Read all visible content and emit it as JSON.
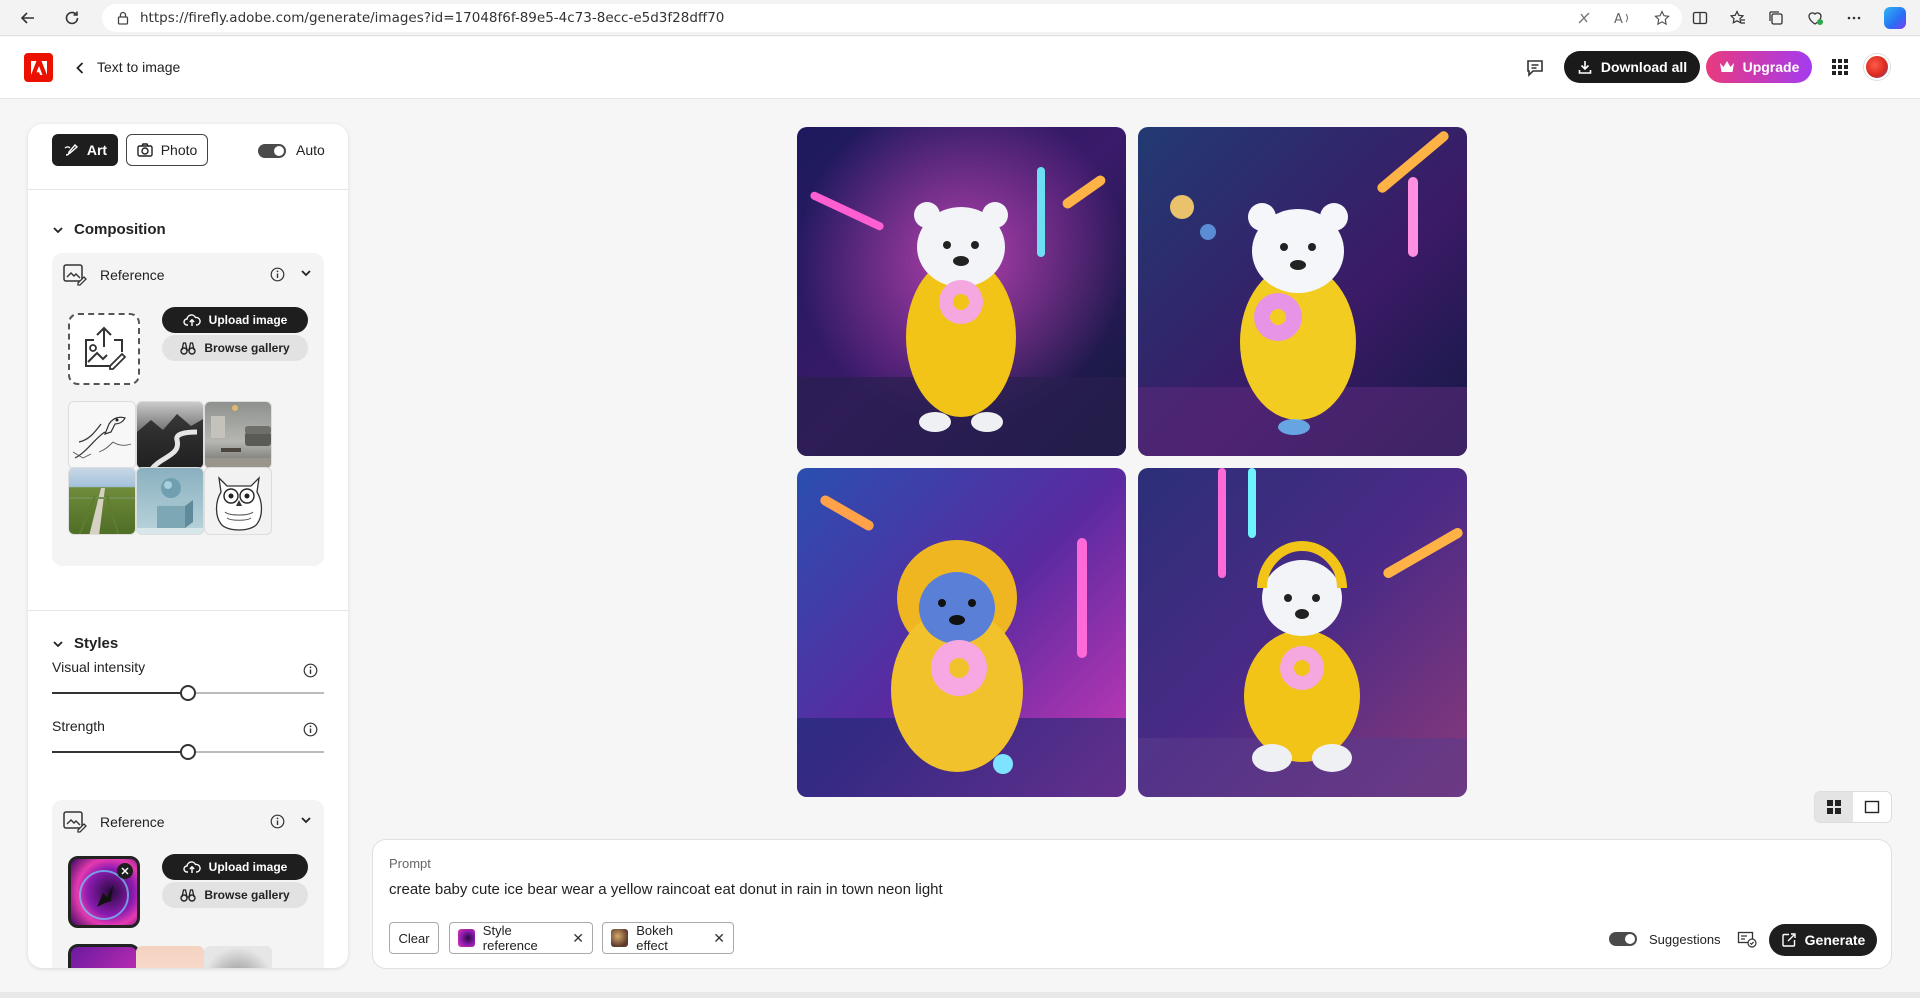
{
  "browser": {
    "url": "https://firefly.adobe.com/generate/images?id=17048f6f-89e5-4c73-8ecc-e5d3f28dff70"
  },
  "header": {
    "title": "Text to image",
    "download_label": "Download all",
    "upgrade_label": "Upgrade"
  },
  "panel": {
    "content_type": {
      "art_label": "Art",
      "photo_label": "Photo",
      "auto_label": "Auto",
      "selected": "Art",
      "auto_on": true
    },
    "composition": {
      "title": "Composition",
      "reference_label": "Reference",
      "upload_label": "Upload image",
      "gallery_label": "Browse gallery",
      "thumbnails": [
        "sketch bird",
        "mountain river",
        "living room",
        "green field road",
        "sphere on block",
        "owl sketch"
      ]
    },
    "styles": {
      "title": "Styles",
      "visual_intensity_label": "Visual intensity",
      "visual_intensity_value": 0.5,
      "strength_label": "Strength",
      "strength_value": 0.5,
      "reference_label": "Reference",
      "upload_label": "Upload image",
      "gallery_label": "Browse gallery"
    }
  },
  "gallery": {
    "images": [
      {
        "desc": "polar bear cub in yellow raincoat holding donut, neon street"
      },
      {
        "desc": "polar bear cub in glossy yellow raincoat holding donut"
      },
      {
        "desc": "bear cub in yellow hooded raincoat with donut, blue neon"
      },
      {
        "desc": "polar bear cub sitting with donut in yellow raincoat"
      }
    ],
    "view_mode": "grid"
  },
  "prompt": {
    "label": "Prompt",
    "text": "create baby cute ice bear wear a yellow raincoat eat donut in rain in town neon light",
    "clear_label": "Clear",
    "tags": [
      {
        "label": "Style reference"
      },
      {
        "label": "Bokeh effect"
      }
    ],
    "suggestions_label": "Suggestions",
    "suggestions_on": true,
    "generate_label": "Generate"
  },
  "colors": {
    "adobe_red": "#eb1000",
    "upgrade_start": "#e93a7d",
    "upgrade_end": "#a43bf0",
    "dark_button": "#1e1e1e"
  }
}
